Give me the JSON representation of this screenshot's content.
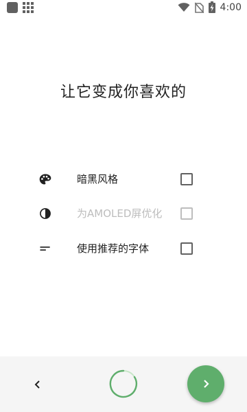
{
  "status_bar": {
    "time": "4:00"
  },
  "title": "让它变成你喜欢的",
  "options": [
    {
      "label": "暗黑风格",
      "icon": "palette-icon",
      "checked": false,
      "enabled": true
    },
    {
      "label": "为AMOLED屏优化",
      "icon": "contrast-icon",
      "checked": false,
      "enabled": false
    },
    {
      "label": "使用推荐的字体",
      "icon": "short-text-icon",
      "checked": false,
      "enabled": true
    }
  ],
  "bottom": {
    "back_icon": "chevron-left-icon",
    "progress_icon": "progress-ring-icon",
    "next_icon": "chevron-right-icon",
    "accent_color": "#5fae6c"
  }
}
